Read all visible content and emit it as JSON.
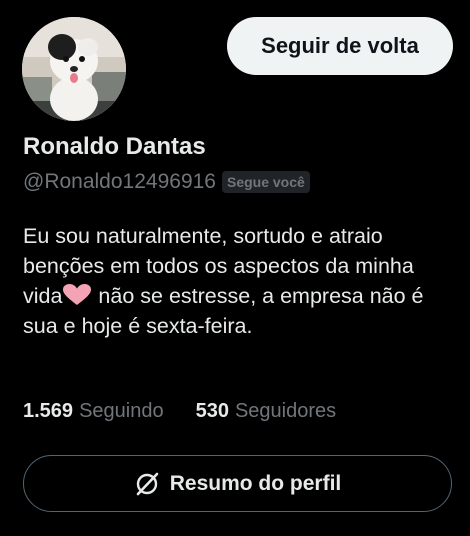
{
  "profile": {
    "display_name": "Ronaldo Dantas",
    "handle": "@Ronaldo12496916",
    "follows_you_badge": "Segue você",
    "bio_part1": "Eu sou naturalmente, sortudo e atraio benções em todos os aspectos da minha vida",
    "bio_emoji": "pink-heart-icon",
    "bio_part2": " não se estresse, a empresa não é sua e hoje é sexta-feira."
  },
  "actions": {
    "follow_back_label": "Seguir de volta",
    "profile_summary_label": "Resumo do perfil",
    "profile_summary_icon": "grok-slash-icon"
  },
  "stats": {
    "following_count": "1.569",
    "following_label": "Seguindo",
    "followers_count": "530",
    "followers_label": "Seguidores"
  },
  "colors": {
    "background": "#000000",
    "primary_text": "#e7e9ea",
    "secondary_text": "#71767b",
    "follow_button_bg": "#eff3f4",
    "heart": "#f4a3b4"
  }
}
